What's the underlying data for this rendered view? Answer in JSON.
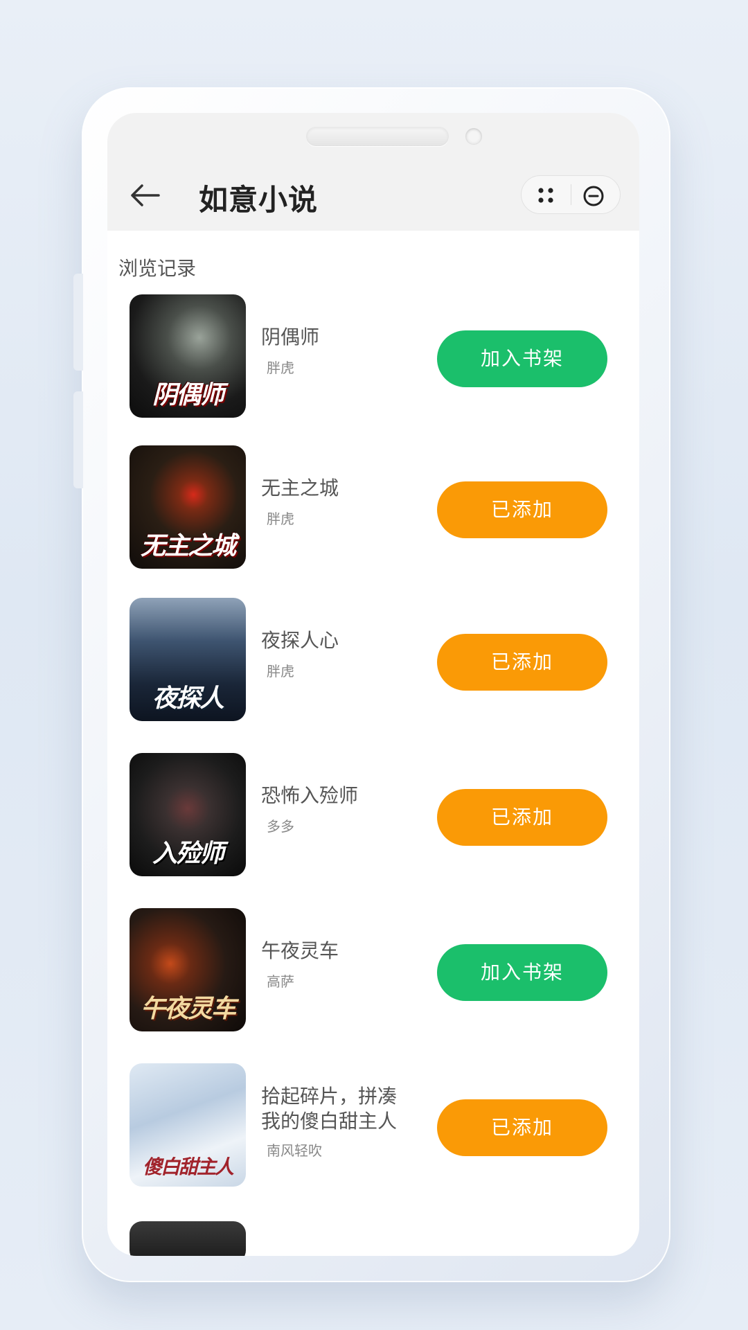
{
  "app": {
    "title": "如意小说"
  },
  "section_title": "浏览记录",
  "colors": {
    "add_button": "#1bbf6b",
    "added_button": "#fa9a06",
    "header_bg": "#f2f2f2"
  },
  "icons": {
    "back": "arrow-left-icon",
    "more": "dots-grid-icon",
    "close": "minus-circle-icon"
  },
  "books": [
    {
      "title": "阴偶师",
      "author": "胖虎",
      "button": "加入书架",
      "state": "add",
      "cover_text": "阴偶师"
    },
    {
      "title": "无主之城",
      "author": "胖虎",
      "button": "已添加",
      "state": "added",
      "cover_text": "无主之城"
    },
    {
      "title": "夜探人心",
      "author": "胖虎",
      "button": "已添加",
      "state": "added",
      "cover_text": "夜探人"
    },
    {
      "title": "恐怖入殓师",
      "author": "多多",
      "button": "已添加",
      "state": "added",
      "cover_text": "入殓师"
    },
    {
      "title": "午夜灵车",
      "author": "高萨",
      "button": "加入书架",
      "state": "add",
      "cover_text": "午夜灵车"
    },
    {
      "title": "拾起碎片，拼凑我的傻白甜主人",
      "title_line1": "拾起碎片，拼凑",
      "title_line2": "我的傻白甜主人",
      "author": "南风轻吹",
      "button": "已添加",
      "state": "added",
      "cover_text": "傻白甜主人"
    }
  ]
}
